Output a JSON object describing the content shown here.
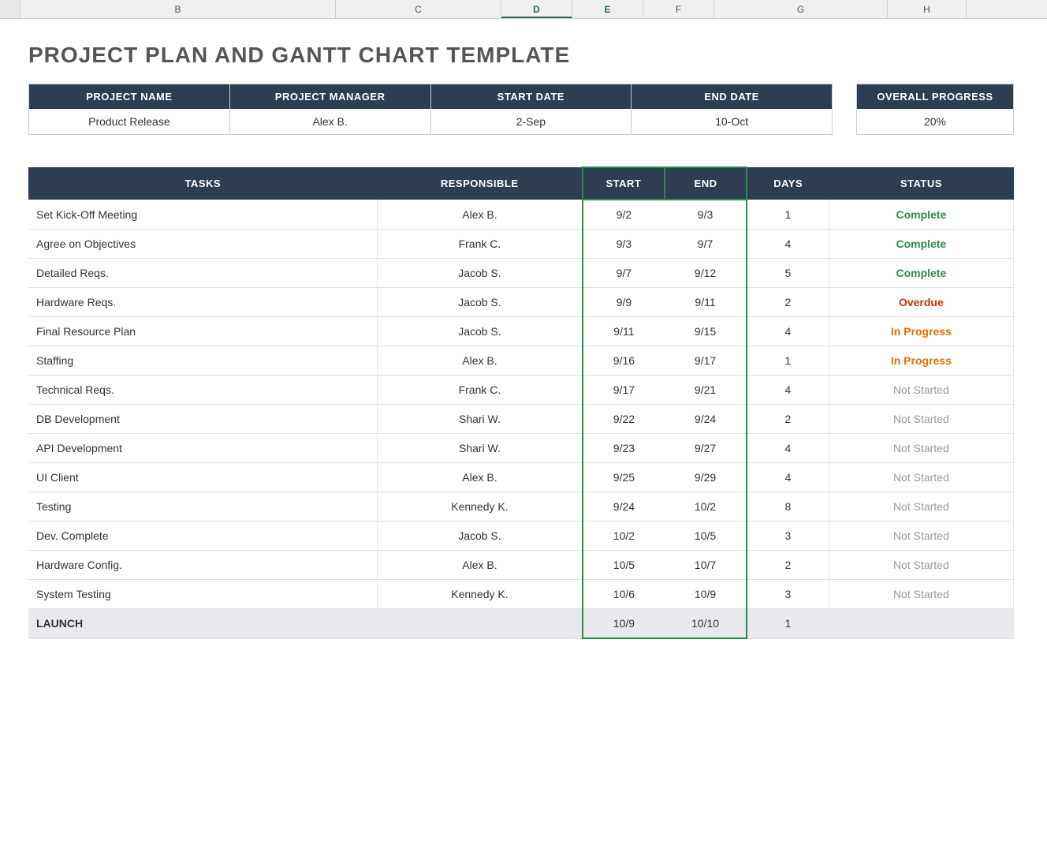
{
  "page": {
    "title": "PROJECT PLAN AND GANTT CHART TEMPLATE",
    "col_headers": [
      "",
      "B",
      "C",
      "D",
      "E",
      "F",
      "G",
      "H"
    ]
  },
  "info_bar": {
    "fields": [
      {
        "header": "PROJECT NAME",
        "value": "Product Release"
      },
      {
        "header": "PROJECT MANAGER",
        "value": "Alex B."
      },
      {
        "header": "START DATE",
        "value": "2-Sep"
      },
      {
        "header": "END DATE",
        "value": "10-Oct"
      }
    ],
    "progress": {
      "header": "OVERALL PROGRESS",
      "value": "20%"
    }
  },
  "tasks_table": {
    "headers": [
      "TASKS",
      "RESPONSIBLE",
      "START",
      "END",
      "DAYS",
      "STATUS"
    ],
    "rows": [
      {
        "task": "Set Kick-Off Meeting",
        "responsible": "Alex B.",
        "start": "9/2",
        "end": "9/3",
        "days": "1",
        "status": "Complete",
        "status_type": "complete",
        "bold": false
      },
      {
        "task": "Agree on Objectives",
        "responsible": "Frank C.",
        "start": "9/3",
        "end": "9/7",
        "days": "4",
        "status": "Complete",
        "status_type": "complete",
        "bold": false
      },
      {
        "task": "Detailed Reqs.",
        "responsible": "Jacob S.",
        "start": "9/7",
        "end": "9/12",
        "days": "5",
        "status": "Complete",
        "status_type": "complete",
        "bold": false
      },
      {
        "task": "Hardware Reqs.",
        "responsible": "Jacob S.",
        "start": "9/9",
        "end": "9/11",
        "days": "2",
        "status": "Overdue",
        "status_type": "overdue",
        "bold": false
      },
      {
        "task": "Final Resource Plan",
        "responsible": "Jacob S.",
        "start": "9/11",
        "end": "9/15",
        "days": "4",
        "status": "In Progress",
        "status_type": "inprogress",
        "bold": false
      },
      {
        "task": "Staffing",
        "responsible": "Alex B.",
        "start": "9/16",
        "end": "9/17",
        "days": "1",
        "status": "In Progress",
        "status_type": "inprogress",
        "bold": false
      },
      {
        "task": "Technical Reqs.",
        "responsible": "Frank C.",
        "start": "9/17",
        "end": "9/21",
        "days": "4",
        "status": "Not Started",
        "status_type": "notstarted",
        "bold": false
      },
      {
        "task": "DB Development",
        "responsible": "Shari W.",
        "start": "9/22",
        "end": "9/24",
        "days": "2",
        "status": "Not Started",
        "status_type": "notstarted",
        "bold": false
      },
      {
        "task": "API Development",
        "responsible": "Shari W.",
        "start": "9/23",
        "end": "9/27",
        "days": "4",
        "status": "Not Started",
        "status_type": "notstarted",
        "bold": false
      },
      {
        "task": "UI Client",
        "responsible": "Alex B.",
        "start": "9/25",
        "end": "9/29",
        "days": "4",
        "status": "Not Started",
        "status_type": "notstarted",
        "bold": false
      },
      {
        "task": "Testing",
        "responsible": "Kennedy K.",
        "start": "9/24",
        "end": "10/2",
        "days": "8",
        "status": "Not Started",
        "status_type": "notstarted",
        "bold": false
      },
      {
        "task": "Dev. Complete",
        "responsible": "Jacob S.",
        "start": "10/2",
        "end": "10/5",
        "days": "3",
        "status": "Not Started",
        "status_type": "notstarted",
        "bold": false
      },
      {
        "task": "Hardware Config.",
        "responsible": "Alex B.",
        "start": "10/5",
        "end": "10/7",
        "days": "2",
        "status": "Not Started",
        "status_type": "notstarted",
        "bold": false
      },
      {
        "task": "System Testing",
        "responsible": "Kennedy K.",
        "start": "10/6",
        "end": "10/9",
        "days": "3",
        "status": "Not Started",
        "status_type": "notstarted",
        "bold": false
      },
      {
        "task": "LAUNCH",
        "responsible": "",
        "start": "10/9",
        "end": "10/10",
        "days": "1",
        "status": "",
        "status_type": "none",
        "bold": true
      }
    ]
  }
}
